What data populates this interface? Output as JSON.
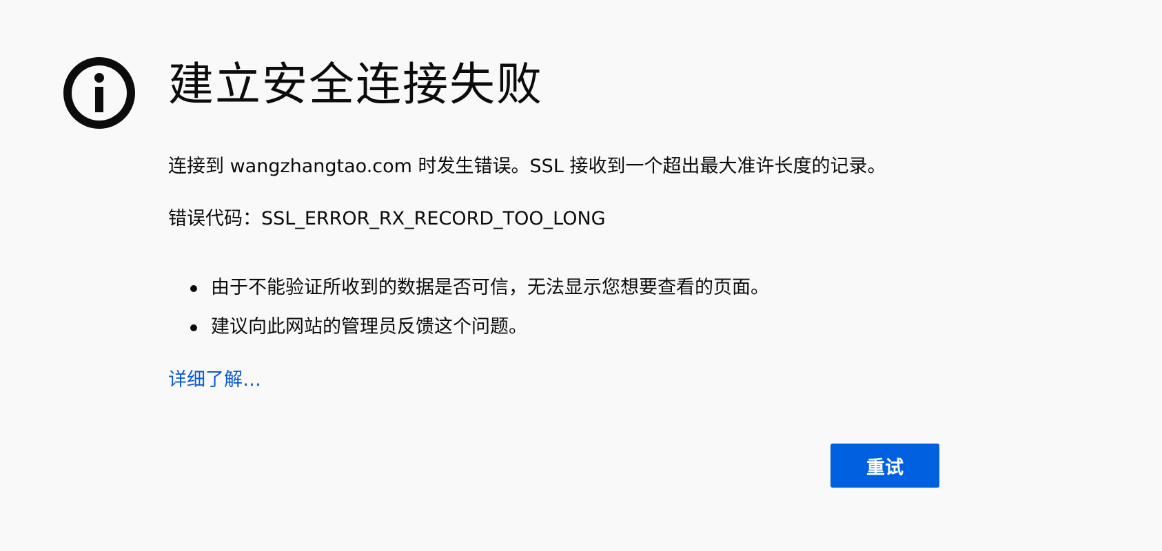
{
  "page": {
    "title": "建立安全连接失败",
    "icon": "info-icon",
    "description": "连接到 wangzhangtao.com 时发生错误。SSL 接收到一个超出最大准许长度的记录。",
    "error_code": "错误代码：SSL_ERROR_RX_RECORD_TOO_LONG",
    "hints": [
      "由于不能验证所收到的数据是否可信，无法显示您想要查看的页面。",
      "建议向此网站的管理员反馈这个问题。"
    ],
    "learn_more_label": "详细了解…",
    "retry_label": "重试"
  },
  "colors": {
    "background": "#f9f9fa",
    "text": "#0c0c0d",
    "link": "#0a5bd5",
    "button": "#0060df",
    "button_text": "#ffffff"
  }
}
